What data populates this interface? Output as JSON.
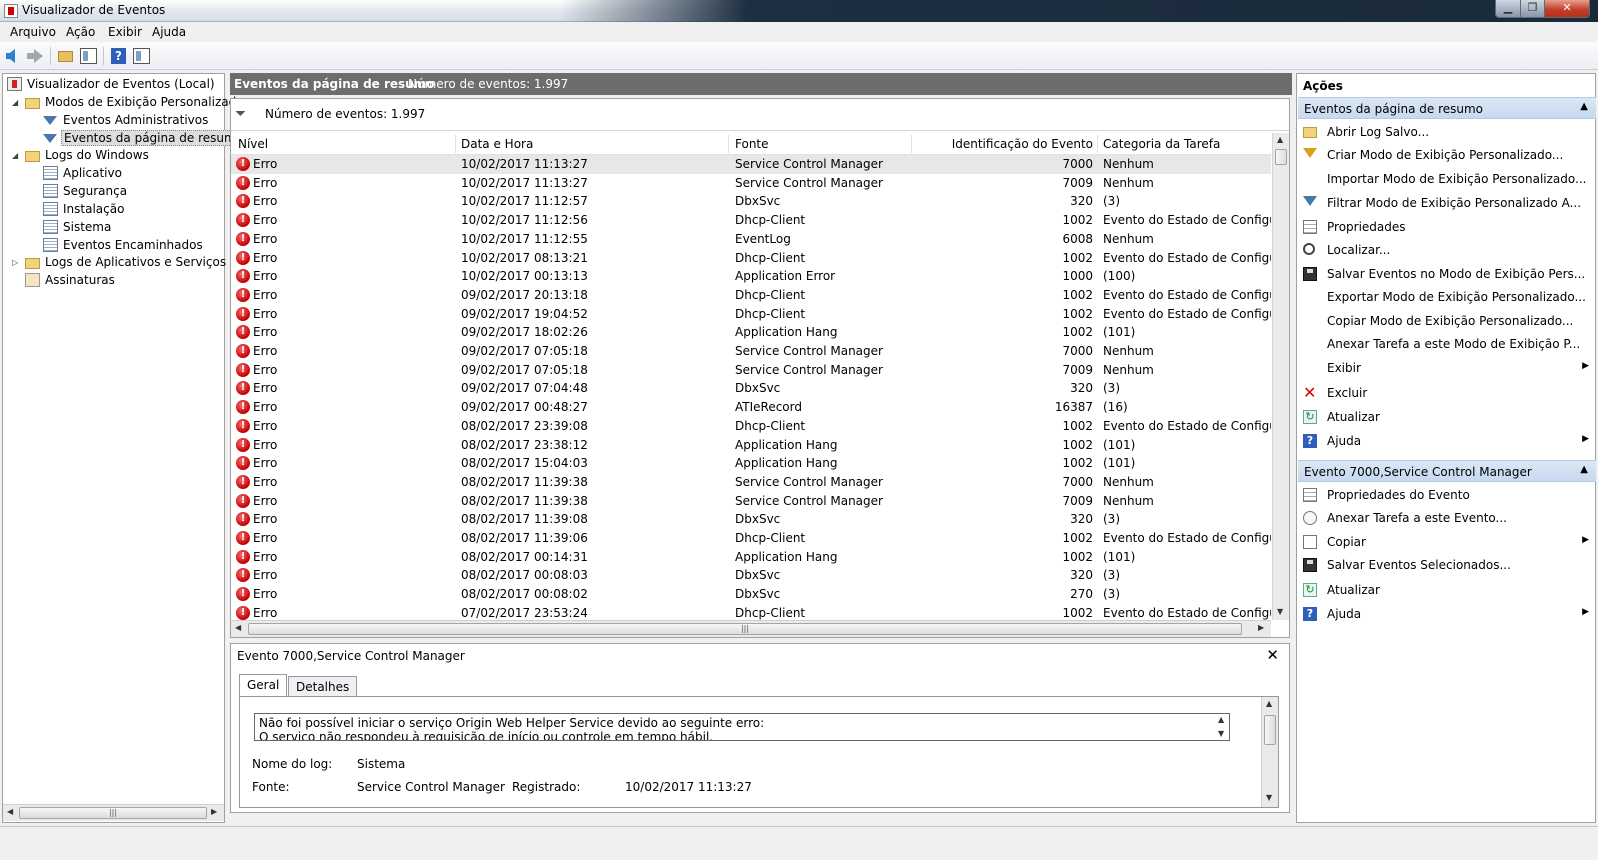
{
  "window": {
    "title": "Visualizador de Eventos"
  },
  "menu": [
    "Arquivo",
    "Ação",
    "Exibir",
    "Ajuda"
  ],
  "tree": {
    "root": "Visualizador de Eventos (Local)",
    "custom_views": "Modos de Exibição Personalizados",
    "admin_events": "Eventos Administrativos",
    "summary_events": "Eventos da página de resumo",
    "windows_logs": "Logs do Windows",
    "app": "Aplicativo",
    "security": "Segurança",
    "setup": "Instalação",
    "system": "Sistema",
    "forwarded": "Eventos Encaminhados",
    "app_services": "Logs de Aplicativos e Serviços",
    "subscriptions": "Assinaturas"
  },
  "center": {
    "title": "Eventos da página de resumo",
    "count_label": "Número de eventos: 1.997",
    "filter_label": "Número de eventos: 1.997"
  },
  "columns": [
    "Nível",
    "Data e Hora",
    "Fonte",
    "Identificação do Evento",
    "Categoria da Tarefa"
  ],
  "events": [
    [
      "Erro",
      "10/02/2017 11:13:27",
      "Service Control Manager",
      "7000",
      "Nenhum"
    ],
    [
      "Erro",
      "10/02/2017 11:13:27",
      "Service Control Manager",
      "7009",
      "Nenhum"
    ],
    [
      "Erro",
      "10/02/2017 11:12:57",
      "DbxSvc",
      "320",
      "(3)"
    ],
    [
      "Erro",
      "10/02/2017 11:12:56",
      "Dhcp-Client",
      "1002",
      "Evento do Estado de Configura..."
    ],
    [
      "Erro",
      "10/02/2017 11:12:55",
      "EventLog",
      "6008",
      "Nenhum"
    ],
    [
      "Erro",
      "10/02/2017 08:13:21",
      "Dhcp-Client",
      "1002",
      "Evento do Estado de Configura..."
    ],
    [
      "Erro",
      "10/02/2017 00:13:13",
      "Application Error",
      "1000",
      "(100)"
    ],
    [
      "Erro",
      "09/02/2017 20:13:18",
      "Dhcp-Client",
      "1002",
      "Evento do Estado de Configura..."
    ],
    [
      "Erro",
      "09/02/2017 19:04:52",
      "Dhcp-Client",
      "1002",
      "Evento do Estado de Configura..."
    ],
    [
      "Erro",
      "09/02/2017 18:02:26",
      "Application Hang",
      "1002",
      "(101)"
    ],
    [
      "Erro",
      "09/02/2017 07:05:18",
      "Service Control Manager",
      "7000",
      "Nenhum"
    ],
    [
      "Erro",
      "09/02/2017 07:05:18",
      "Service Control Manager",
      "7009",
      "Nenhum"
    ],
    [
      "Erro",
      "09/02/2017 07:04:48",
      "DbxSvc",
      "320",
      "(3)"
    ],
    [
      "Erro",
      "09/02/2017 00:48:27",
      "ATIeRecord",
      "16387",
      "(16)"
    ],
    [
      "Erro",
      "08/02/2017 23:39:08",
      "Dhcp-Client",
      "1002",
      "Evento do Estado de Configura..."
    ],
    [
      "Erro",
      "08/02/2017 23:38:12",
      "Application Hang",
      "1002",
      "(101)"
    ],
    [
      "Erro",
      "08/02/2017 15:04:03",
      "Application Hang",
      "1002",
      "(101)"
    ],
    [
      "Erro",
      "08/02/2017 11:39:38",
      "Service Control Manager",
      "7000",
      "Nenhum"
    ],
    [
      "Erro",
      "08/02/2017 11:39:38",
      "Service Control Manager",
      "7009",
      "Nenhum"
    ],
    [
      "Erro",
      "08/02/2017 11:39:08",
      "DbxSvc",
      "320",
      "(3)"
    ],
    [
      "Erro",
      "08/02/2017 11:39:06",
      "Dhcp-Client",
      "1002",
      "Evento do Estado de Configura..."
    ],
    [
      "Erro",
      "08/02/2017 00:14:31",
      "Application Hang",
      "1002",
      "(101)"
    ],
    [
      "Erro",
      "08/02/2017 00:08:03",
      "DbxSvc",
      "320",
      "(3)"
    ],
    [
      "Erro",
      "08/02/2017 00:08:02",
      "DbxSvc",
      "270",
      "(3)"
    ],
    [
      "Erro",
      "07/02/2017 23:53:24",
      "Dhcp-Client",
      "1002",
      "Evento do Estado de Configura..."
    ]
  ],
  "detail": {
    "title": "Evento 7000,Service Control Manager",
    "tabs": [
      "Geral",
      "Detalhes"
    ],
    "description_line1": "Não foi possível iniciar o serviço Origin Web Helper Service devido ao seguinte erro:",
    "description_line2": "O serviço não respondeu à requisição de início ou controle em tempo hábil.",
    "log_name_label": "Nome do log:",
    "log_name_value": "Sistema",
    "source_label": "Fonte:",
    "source_value": "Service Control Manager",
    "registered_label": "Registrado:",
    "registered_value": "10/02/2017 11:13:27"
  },
  "actions": {
    "title": "Ações",
    "section1": "Eventos da página de resumo",
    "items1": [
      "Abrir Log Salvo...",
      "Criar Modo de Exibição Personalizado...",
      "Importar Modo de Exibição Personalizado...",
      "Filtrar Modo de Exibição Personalizado A...",
      "Propriedades",
      "Localizar...",
      "Salvar Eventos no Modo de Exibição Pers...",
      "Exportar Modo de Exibição Personalizado...",
      "Copiar Modo de Exibição Personalizado...",
      "Anexar Tarefa a este Modo de Exibição P...",
      "Exibir",
      "Excluir",
      "Atualizar",
      "Ajuda"
    ],
    "section2": "Evento 7000,Service Control Manager",
    "items2": [
      "Propriedades do Evento",
      "Anexar Tarefa a este Evento...",
      "Copiar",
      "Salvar Eventos Selecionados...",
      "Atualizar",
      "Ajuda"
    ]
  }
}
